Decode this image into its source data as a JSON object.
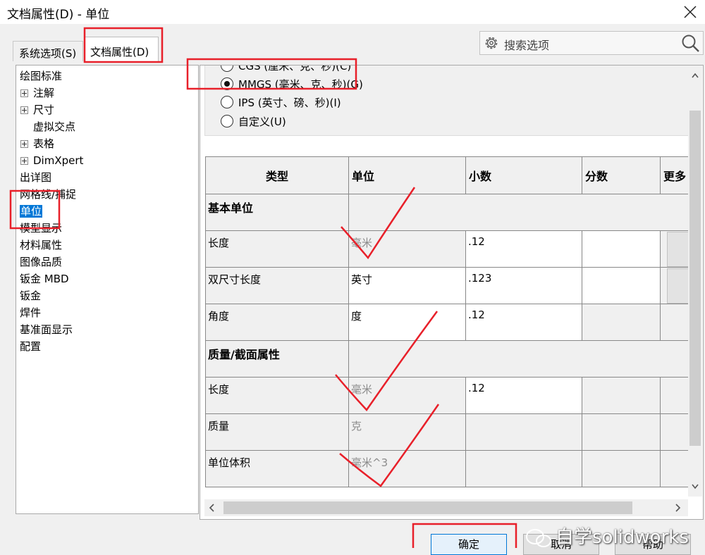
{
  "window": {
    "title": "文档属性(D) - 单位"
  },
  "tabs": [
    {
      "label": "系统选项(S)"
    },
    {
      "label": "文档属性(D)"
    }
  ],
  "search": {
    "placeholder": "搜索选项"
  },
  "tree": {
    "items": [
      {
        "label": "绘图标准"
      },
      {
        "label": "注解"
      },
      {
        "label": "尺寸"
      },
      {
        "label": "虚拟交点"
      },
      {
        "label": "表格"
      },
      {
        "label": "DimXpert"
      },
      {
        "label": "出详图"
      },
      {
        "label": "网格线/捕捉"
      },
      {
        "label": "单位"
      },
      {
        "label": "模型显示"
      },
      {
        "label": "材料属性"
      },
      {
        "label": "图像品质"
      },
      {
        "label": "钣金 MBD"
      },
      {
        "label": "钣金"
      },
      {
        "label": "焊件"
      },
      {
        "label": "基准面显示"
      },
      {
        "label": "配置"
      }
    ]
  },
  "unit_system": {
    "options": [
      {
        "label": "CGS (厘米、克、秒)(C)",
        "checked": false
      },
      {
        "label": "MMGS (毫米、克、秒)(G)",
        "checked": true
      },
      {
        "label": "IPS (英寸、磅、秒)(I)",
        "checked": false
      },
      {
        "label": "自定义(U)",
        "checked": false
      }
    ]
  },
  "table": {
    "headers": {
      "type": "类型",
      "unit": "单位",
      "decimals": "小数",
      "fractions": "分数",
      "more": "更多"
    },
    "basic_units": {
      "title": "基本单位",
      "rows": [
        {
          "type": "长度",
          "unit": "毫米",
          "decimals": ".12"
        },
        {
          "type": "双尺寸长度",
          "unit": "英寸",
          "decimals": ".123"
        },
        {
          "type": "角度",
          "unit": "度",
          "decimals": ".12"
        }
      ]
    },
    "mass_section": {
      "title": "质量/截面属性",
      "rows": [
        {
          "type": "长度",
          "unit": "毫米",
          "decimals": ".12"
        },
        {
          "type": "质量",
          "unit": "克",
          "decimals": ""
        },
        {
          "type": "单位体积",
          "unit": "毫米^3",
          "decimals": ""
        }
      ]
    }
  },
  "buttons": {
    "ok": "确定",
    "cancel": "取消",
    "help": "帮助"
  },
  "watermark": {
    "text": "自学solidworks"
  },
  "annotation_color": "#e8202a"
}
